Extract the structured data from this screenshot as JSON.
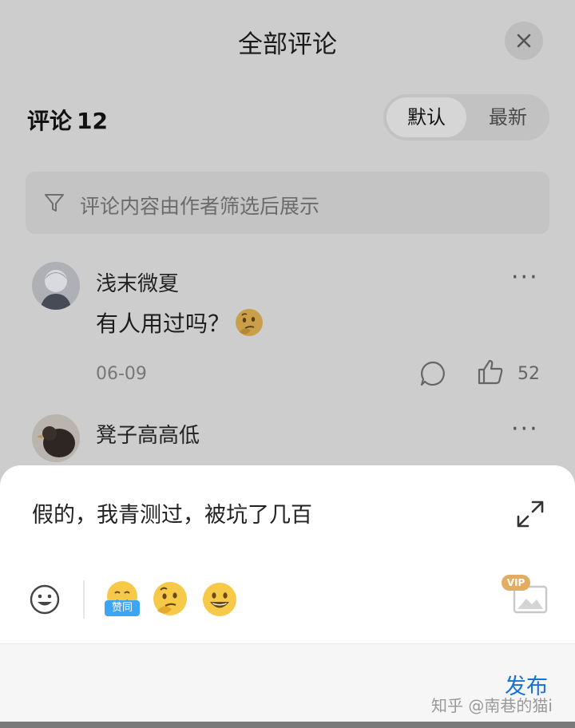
{
  "header": {
    "title": "全部评论"
  },
  "comments_header": {
    "label": "评论",
    "count": "12"
  },
  "sort": {
    "default_label": "默认",
    "newest_label": "最新"
  },
  "filter": {
    "text": "评论内容由作者筛选后展示"
  },
  "comments": [
    {
      "author": "浅末微夏",
      "text": "有人用过吗？",
      "emoji": "thinking-face",
      "date": "06-09",
      "likes": "52",
      "more": "···"
    },
    {
      "author": "凳子高高低",
      "more": "···"
    }
  ],
  "composer": {
    "draft_text": "假的，我青测过，被坑了几百",
    "emojis": [
      "agree-emoji",
      "thinking-face",
      "grinning-face"
    ],
    "agree_tag": "赞同",
    "vip_badge": "VIP",
    "publish_label": "发布"
  },
  "watermark": "知乎 @南巷的猫i",
  "colors": {
    "accent": "#1772d8",
    "overlay": "#cdcdcd",
    "vip": "#e2ad63",
    "agree_tag": "#3da5f5"
  }
}
